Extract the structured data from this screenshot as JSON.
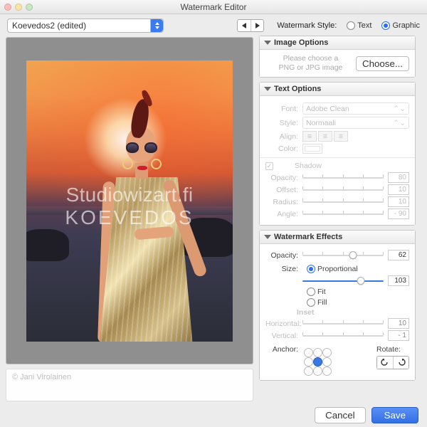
{
  "window": {
    "title": "Watermark Editor"
  },
  "preset": {
    "name": "Koevedos2 (edited)"
  },
  "style": {
    "label": "Watermark Style:",
    "text_label": "Text",
    "graphic_label": "Graphic",
    "selected": "Graphic"
  },
  "preview": {
    "watermark_line1": "Studiowizart.fi",
    "watermark_line2": "KOEVEDOS",
    "credit": "© Jani Virolainen"
  },
  "image_options": {
    "title": "Image Options",
    "help1": "Please choose a",
    "help2": "PNG or JPG image",
    "choose": "Choose..."
  },
  "text_options": {
    "title": "Text Options",
    "font_label": "Font:",
    "font_value": "Adobe Clean",
    "style_label": "Style:",
    "style_value": "Normaali",
    "align_label": "Align:",
    "color_label": "Color:",
    "shadow_label": "Shadow",
    "opacity_label": "Opacity:",
    "opacity_value": "80",
    "offset_label": "Offset:",
    "offset_value": "10",
    "radius_label": "Radius:",
    "radius_value": "10",
    "angle_label": "Angle:",
    "angle_value": "- 90"
  },
  "effects": {
    "title": "Watermark Effects",
    "opacity_label": "Opacity:",
    "opacity_value": "62",
    "size_label": "Size:",
    "size_mode_prop": "Proportional",
    "size_mode_fit": "Fit",
    "size_mode_fill": "Fill",
    "size_value": "103",
    "inset_label": "Inset",
    "h_label": "Horizontal:",
    "h_value": "10",
    "v_label": "Vertical:",
    "v_value": "- 1",
    "anchor_label": "Anchor:",
    "rotate_label": "Rotate:"
  },
  "buttons": {
    "cancel": "Cancel",
    "save": "Save"
  }
}
